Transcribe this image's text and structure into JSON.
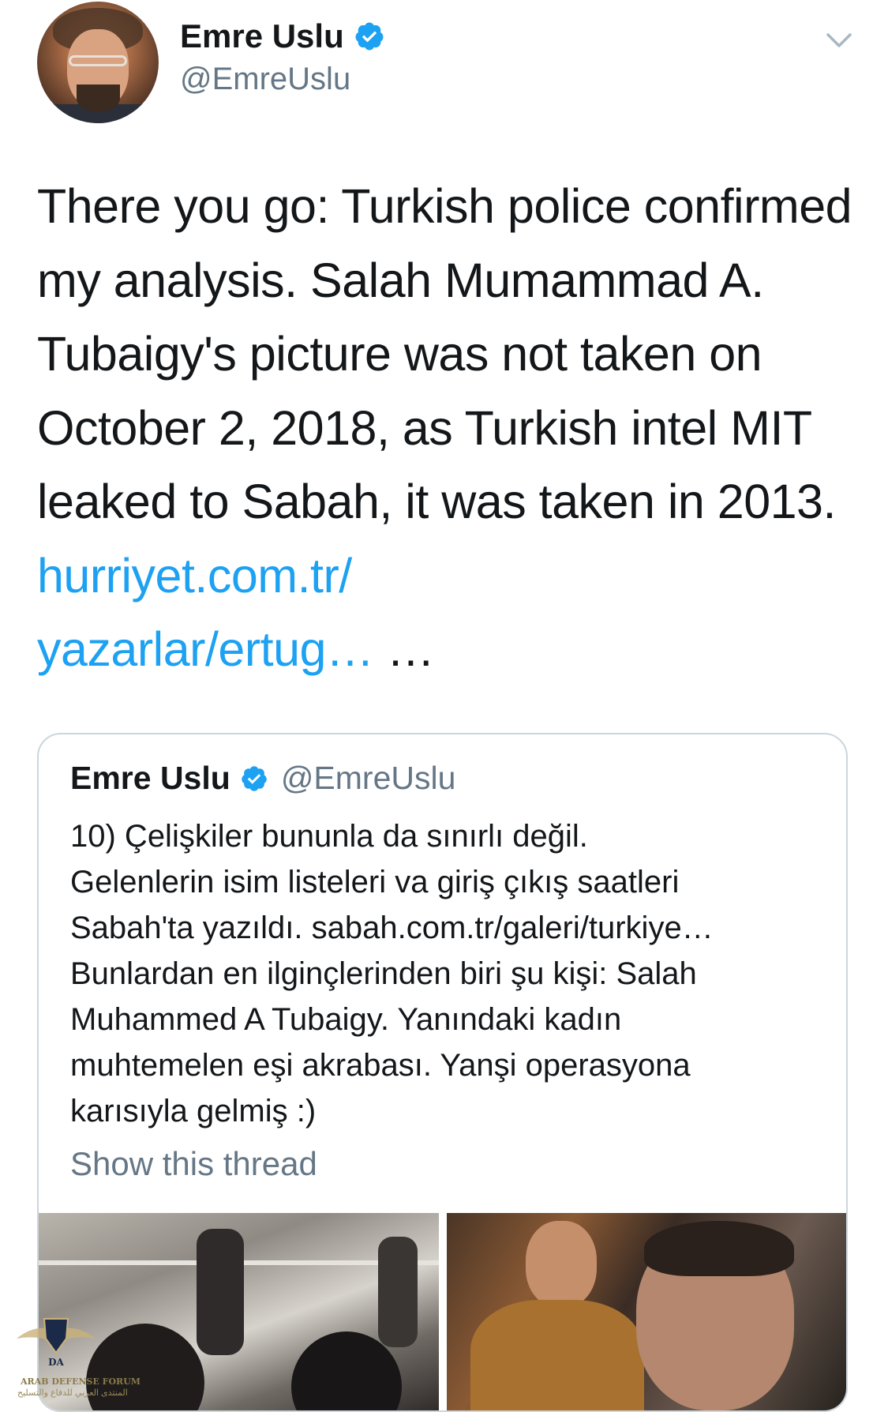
{
  "author": {
    "name": "Emre Uslu",
    "handle": "@EmreUslu",
    "verified": true
  },
  "icons": {
    "verified": "verified-badge-icon",
    "menu": "chevron-down-icon"
  },
  "tweet": {
    "text": "There you go: Turkish police confirmed my analysis. Salah Mumammad A. Tubaigy's picture was not taken on October 2, 2018, as Turkish intel MIT leaked to Sabah, it was taken in 2013.",
    "link_line1": "hurriyet.com.tr/",
    "link_line2": "yazarlar/ertug…",
    "ellipsis": "…"
  },
  "quoted": {
    "name": "Emre Uslu",
    "handle": "@EmreUslu",
    "lines": [
      "10) Çelişkiler bununla da sınırlı değil.",
      "Gelenlerin isim listeleri va giriş çıkış saatleri",
      "Sabah'ta yazıldı. sabah.com.tr/galeri/turkiye…",
      "Bunlardan en ilginçlerinden biri şu kişi: Salah",
      "Muhammed A Tubaigy.  Yanındaki kadın",
      "muhtemelen eşi akrabası. Yanşi operasyona",
      "karısıyla gelmiş :)"
    ],
    "show_thread": "Show this thread"
  },
  "watermark": {
    "line1": "ARAB DEFENSE FORUM",
    "line2": "المنتدى العربي للدفاع والتسليح"
  },
  "colors": {
    "text": "#14171a",
    "secondary": "#657786",
    "link": "#1da1f2",
    "border": "#ccd6dd",
    "verified": "#1da1f2"
  }
}
